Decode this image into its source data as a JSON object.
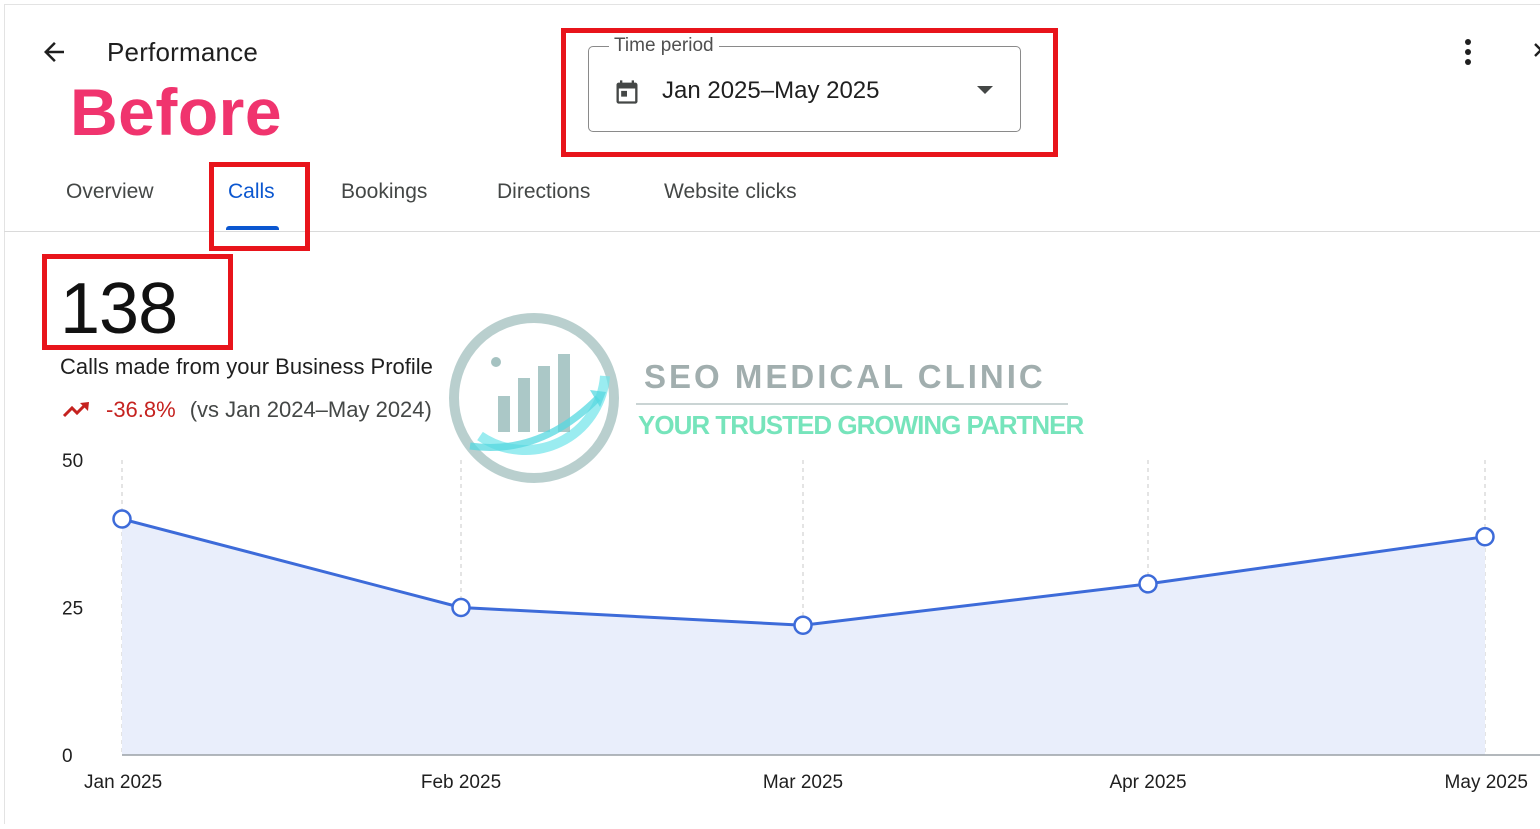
{
  "header": {
    "title": "Performance",
    "overlay_label": "Before",
    "back_icon": "arrow-left-icon",
    "menu_icon": "more-vert-icon",
    "close_icon": "close-icon"
  },
  "time_period": {
    "label": "Time period",
    "value": "Jan 2025–May 2025",
    "icon": "calendar-icon"
  },
  "tabs": [
    {
      "label": "Overview",
      "active": false
    },
    {
      "label": "Calls",
      "active": true
    },
    {
      "label": "Bookings",
      "active": false
    },
    {
      "label": "Directions",
      "active": false
    },
    {
      "label": "Website clicks",
      "active": false
    }
  ],
  "metric": {
    "value": "138",
    "description": "Calls made from your Business Profile",
    "change": "-36.8%",
    "comparison": "(vs Jan 2024–May 2024)",
    "trend_icon": "trending-down-icon"
  },
  "watermark": {
    "name": "SEO MEDICAL CLINIC",
    "tagline": "YOUR TRUSTED GROWING PARTNER"
  },
  "colors": {
    "accent": "#0b57d0",
    "negative": "#c5221f",
    "highlight_box": "#e8141b",
    "overlay_label": "#f0346e",
    "line": "#3d6bd9",
    "area_fill": "#e9eefb"
  },
  "chart_data": {
    "type": "area",
    "categories": [
      "Jan 2025",
      "Feb 2025",
      "Mar 2025",
      "Apr 2025",
      "May 2025"
    ],
    "values": [
      40,
      25,
      22,
      29,
      37
    ],
    "y_ticks": [
      "0",
      "25",
      "50"
    ],
    "ylim": [
      0,
      50
    ],
    "grid": "vertical-dashed",
    "title": "",
    "xlabel": "",
    "ylabel": ""
  }
}
